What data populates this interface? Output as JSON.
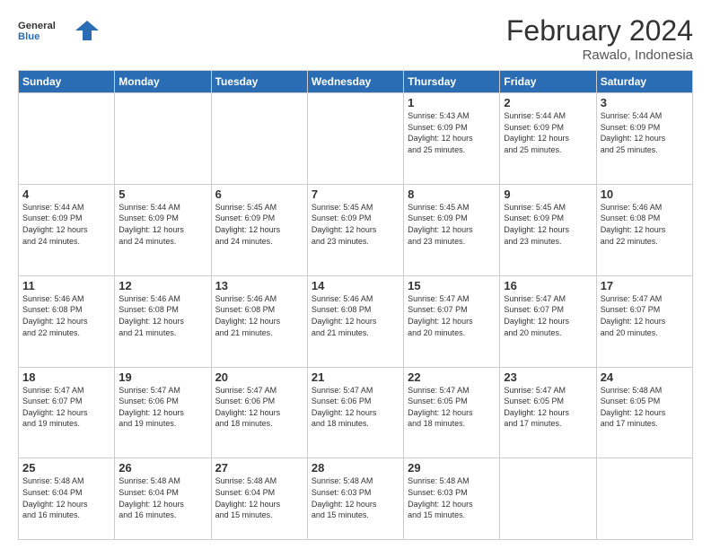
{
  "header": {
    "logo_general": "General",
    "logo_blue": "Blue",
    "month_year": "February 2024",
    "location": "Rawalo, Indonesia"
  },
  "days_of_week": [
    "Sunday",
    "Monday",
    "Tuesday",
    "Wednesday",
    "Thursday",
    "Friday",
    "Saturday"
  ],
  "weeks": [
    [
      {
        "day": "",
        "info": ""
      },
      {
        "day": "",
        "info": ""
      },
      {
        "day": "",
        "info": ""
      },
      {
        "day": "",
        "info": ""
      },
      {
        "day": "1",
        "info": "Sunrise: 5:43 AM\nSunset: 6:09 PM\nDaylight: 12 hours\nand 25 minutes."
      },
      {
        "day": "2",
        "info": "Sunrise: 5:44 AM\nSunset: 6:09 PM\nDaylight: 12 hours\nand 25 minutes."
      },
      {
        "day": "3",
        "info": "Sunrise: 5:44 AM\nSunset: 6:09 PM\nDaylight: 12 hours\nand 25 minutes."
      }
    ],
    [
      {
        "day": "4",
        "info": "Sunrise: 5:44 AM\nSunset: 6:09 PM\nDaylight: 12 hours\nand 24 minutes."
      },
      {
        "day": "5",
        "info": "Sunrise: 5:44 AM\nSunset: 6:09 PM\nDaylight: 12 hours\nand 24 minutes."
      },
      {
        "day": "6",
        "info": "Sunrise: 5:45 AM\nSunset: 6:09 PM\nDaylight: 12 hours\nand 24 minutes."
      },
      {
        "day": "7",
        "info": "Sunrise: 5:45 AM\nSunset: 6:09 PM\nDaylight: 12 hours\nand 23 minutes."
      },
      {
        "day": "8",
        "info": "Sunrise: 5:45 AM\nSunset: 6:09 PM\nDaylight: 12 hours\nand 23 minutes."
      },
      {
        "day": "9",
        "info": "Sunrise: 5:45 AM\nSunset: 6:09 PM\nDaylight: 12 hours\nand 23 minutes."
      },
      {
        "day": "10",
        "info": "Sunrise: 5:46 AM\nSunset: 6:08 PM\nDaylight: 12 hours\nand 22 minutes."
      }
    ],
    [
      {
        "day": "11",
        "info": "Sunrise: 5:46 AM\nSunset: 6:08 PM\nDaylight: 12 hours\nand 22 minutes."
      },
      {
        "day": "12",
        "info": "Sunrise: 5:46 AM\nSunset: 6:08 PM\nDaylight: 12 hours\nand 21 minutes."
      },
      {
        "day": "13",
        "info": "Sunrise: 5:46 AM\nSunset: 6:08 PM\nDaylight: 12 hours\nand 21 minutes."
      },
      {
        "day": "14",
        "info": "Sunrise: 5:46 AM\nSunset: 6:08 PM\nDaylight: 12 hours\nand 21 minutes."
      },
      {
        "day": "15",
        "info": "Sunrise: 5:47 AM\nSunset: 6:07 PM\nDaylight: 12 hours\nand 20 minutes."
      },
      {
        "day": "16",
        "info": "Sunrise: 5:47 AM\nSunset: 6:07 PM\nDaylight: 12 hours\nand 20 minutes."
      },
      {
        "day": "17",
        "info": "Sunrise: 5:47 AM\nSunset: 6:07 PM\nDaylight: 12 hours\nand 20 minutes."
      }
    ],
    [
      {
        "day": "18",
        "info": "Sunrise: 5:47 AM\nSunset: 6:07 PM\nDaylight: 12 hours\nand 19 minutes."
      },
      {
        "day": "19",
        "info": "Sunrise: 5:47 AM\nSunset: 6:06 PM\nDaylight: 12 hours\nand 19 minutes."
      },
      {
        "day": "20",
        "info": "Sunrise: 5:47 AM\nSunset: 6:06 PM\nDaylight: 12 hours\nand 18 minutes."
      },
      {
        "day": "21",
        "info": "Sunrise: 5:47 AM\nSunset: 6:06 PM\nDaylight: 12 hours\nand 18 minutes."
      },
      {
        "day": "22",
        "info": "Sunrise: 5:47 AM\nSunset: 6:05 PM\nDaylight: 12 hours\nand 18 minutes."
      },
      {
        "day": "23",
        "info": "Sunrise: 5:47 AM\nSunset: 6:05 PM\nDaylight: 12 hours\nand 17 minutes."
      },
      {
        "day": "24",
        "info": "Sunrise: 5:48 AM\nSunset: 6:05 PM\nDaylight: 12 hours\nand 17 minutes."
      }
    ],
    [
      {
        "day": "25",
        "info": "Sunrise: 5:48 AM\nSunset: 6:04 PM\nDaylight: 12 hours\nand 16 minutes."
      },
      {
        "day": "26",
        "info": "Sunrise: 5:48 AM\nSunset: 6:04 PM\nDaylight: 12 hours\nand 16 minutes."
      },
      {
        "day": "27",
        "info": "Sunrise: 5:48 AM\nSunset: 6:04 PM\nDaylight: 12 hours\nand 15 minutes."
      },
      {
        "day": "28",
        "info": "Sunrise: 5:48 AM\nSunset: 6:03 PM\nDaylight: 12 hours\nand 15 minutes."
      },
      {
        "day": "29",
        "info": "Sunrise: 5:48 AM\nSunset: 6:03 PM\nDaylight: 12 hours\nand 15 minutes."
      },
      {
        "day": "",
        "info": ""
      },
      {
        "day": "",
        "info": ""
      }
    ]
  ]
}
